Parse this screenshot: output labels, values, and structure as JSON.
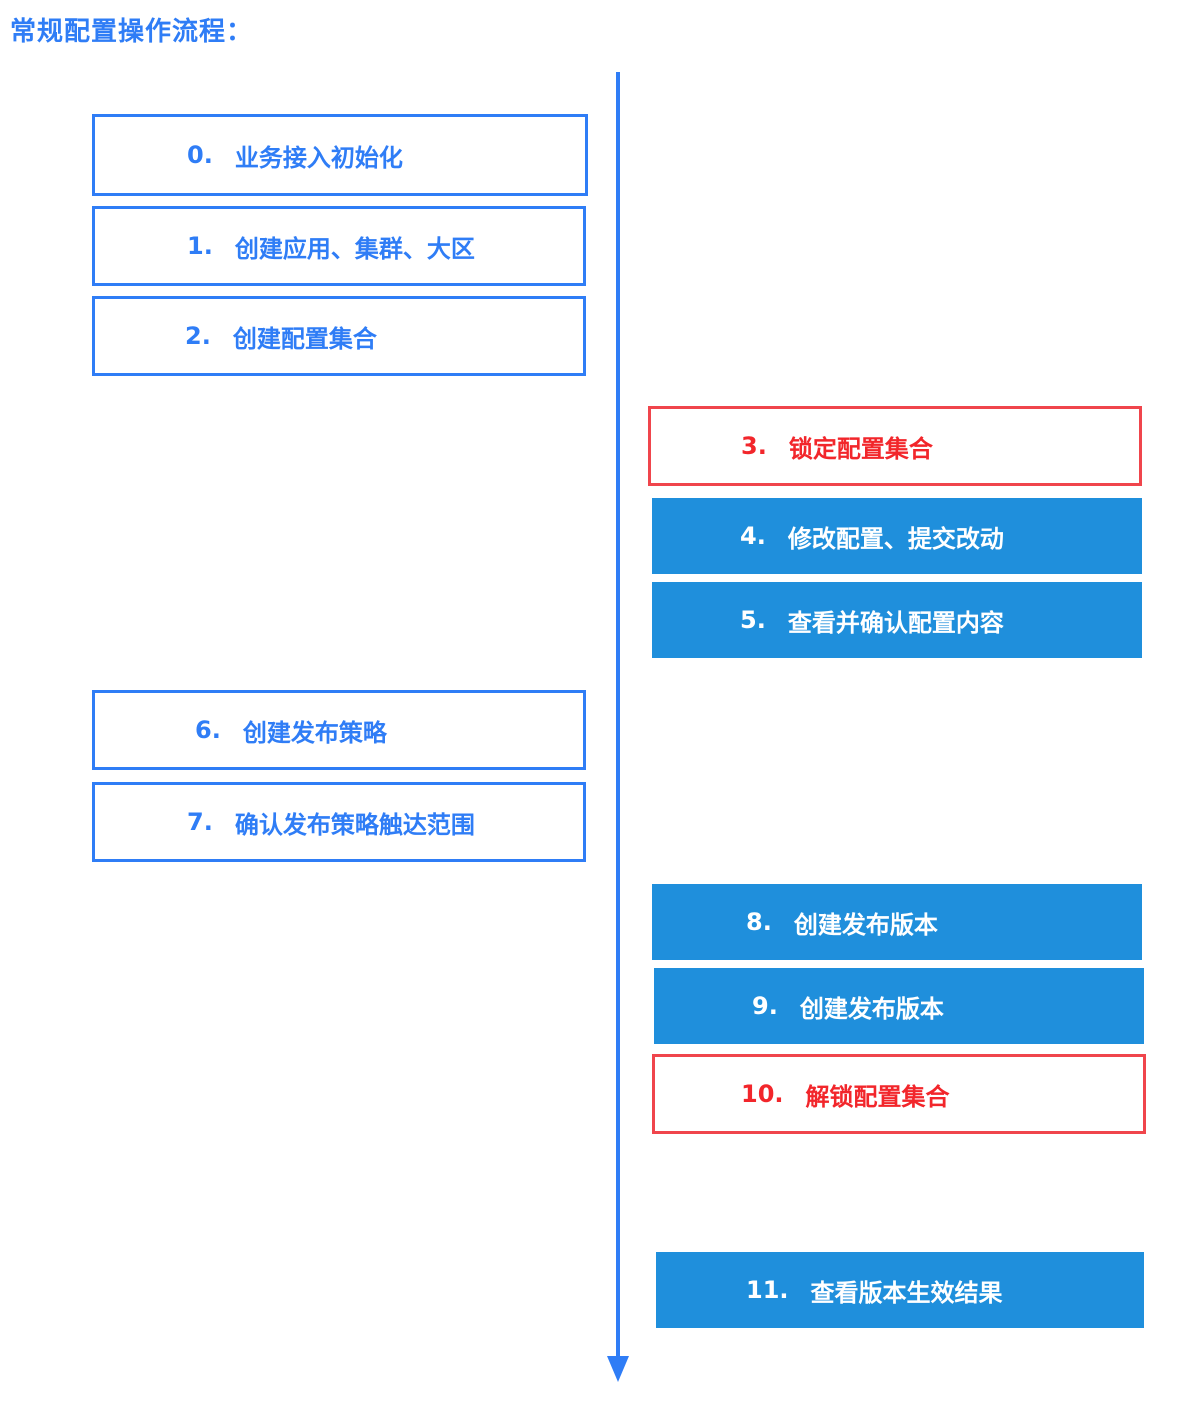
{
  "title": "常规配置操作流程：",
  "colors": {
    "accent_blue": "#2f7df6",
    "filled_blue": "#1f8fdc",
    "alert_red": "#f2262b",
    "alert_red_border": "#f0454c"
  },
  "steps": [
    {
      "number": "0.",
      "label": "业务接入初始化",
      "lane": "left",
      "style": "outline-blue"
    },
    {
      "number": "1.",
      "label": "创建应用、集群、大区",
      "lane": "left",
      "style": "outline-blue"
    },
    {
      "number": "2.",
      "label": "创建配置集合",
      "lane": "left",
      "style": "outline-blue"
    },
    {
      "number": "3.",
      "label": "锁定配置集合",
      "lane": "right",
      "style": "outline-red"
    },
    {
      "number": "4.",
      "label": "修改配置、提交改动",
      "lane": "right",
      "style": "filled-blue"
    },
    {
      "number": "5.",
      "label": "查看并确认配置内容",
      "lane": "right",
      "style": "filled-blue"
    },
    {
      "number": "6.",
      "label": "创建发布策略",
      "lane": "left",
      "style": "outline-blue"
    },
    {
      "number": "7.",
      "label": "确认发布策略触达范围",
      "lane": "left",
      "style": "outline-blue"
    },
    {
      "number": "8.",
      "label": "创建发布版本",
      "lane": "right",
      "style": "filled-blue"
    },
    {
      "number": "9.",
      "label": "创建发布版本",
      "lane": "right",
      "style": "filled-blue"
    },
    {
      "number": "10.",
      "label": "解锁配置集合",
      "lane": "right",
      "style": "outline-red"
    },
    {
      "number": "11.",
      "label": "查看版本生效结果",
      "lane": "right",
      "style": "filled-blue"
    }
  ]
}
